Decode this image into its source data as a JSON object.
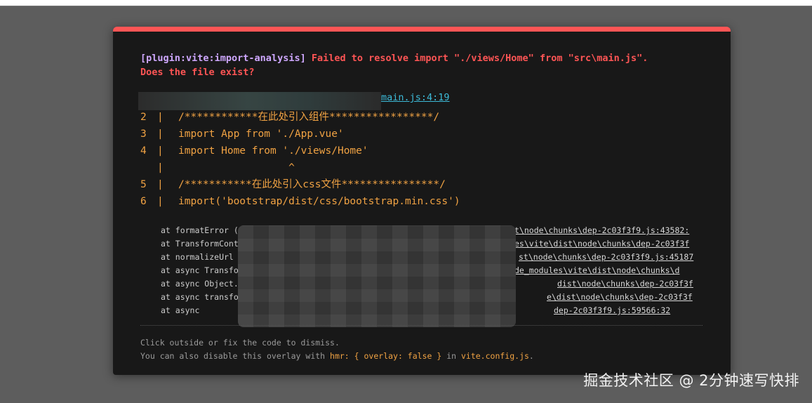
{
  "error": {
    "plugin": "[plugin:vite:import-analysis]",
    "message_line1": " Failed to resolve import \"./views/Home\" from \"src\\main.js\".",
    "message_line2": "Does the file exist?",
    "file_link": "main.js:4:19"
  },
  "code_frame": [
    {
      "ln": "2",
      "bar": "|",
      "code": "/************在此处引入组件*****************/"
    },
    {
      "ln": "3",
      "bar": "|",
      "code": "import App from './App.vue'"
    },
    {
      "ln": "4",
      "bar": "|",
      "code": "import Home from './views/Home'"
    },
    {
      "ln": "",
      "bar": "|",
      "code": "                  ^"
    },
    {
      "ln": "5",
      "bar": "|",
      "code": "/***********在此处引入css文件****************/"
    },
    {
      "ln": "6",
      "bar": "|",
      "code": "import('bootstrap/dist/css/bootstrap.min.css')"
    }
  ],
  "stack": [
    {
      "text": "at formatError (",
      "loc": "t\\node\\chunks\\dep-2c03f3f9.js:43582:"
    },
    {
      "text": "at TransformCont",
      "loc": "es\\vite\\dist\\node\\chunks\\dep-2c03f3f"
    },
    {
      "text": "at normalizeUrl",
      "loc": "st\\node\\chunks\\dep-2c03f3f9.js:45187"
    },
    {
      "text": "at async Transfo",
      "loc": "de_modules\\vite\\dist\\node\\chunks\\d"
    },
    {
      "text": "at async Object.",
      "loc": "dist\\node\\chunks\\dep-2c03f3f"
    },
    {
      "text": "at async transform",
      "loc": "e\\dist\\node\\chunks\\dep-2c03f3f"
    },
    {
      "text": "at async",
      "loc": "dep-2c03f3f9.js:59566:32"
    }
  ],
  "tip": {
    "line1": "Click outside or fix the code to dismiss.",
    "line2_prefix": "You can also disable this overlay with ",
    "line2_code1": "hmr: { overlay: false }",
    "line2_mid": " in ",
    "line2_code2": "vite.config.js",
    "line2_suffix": "."
  },
  "watermark": "掘金技术社区 @ 2分钟速写快排",
  "colors": {
    "accent_red": "#ff5555",
    "plugin_purple": "#cfa8ff",
    "link_cyan": "#3dbbd9",
    "code_orange": "#f0a243"
  }
}
